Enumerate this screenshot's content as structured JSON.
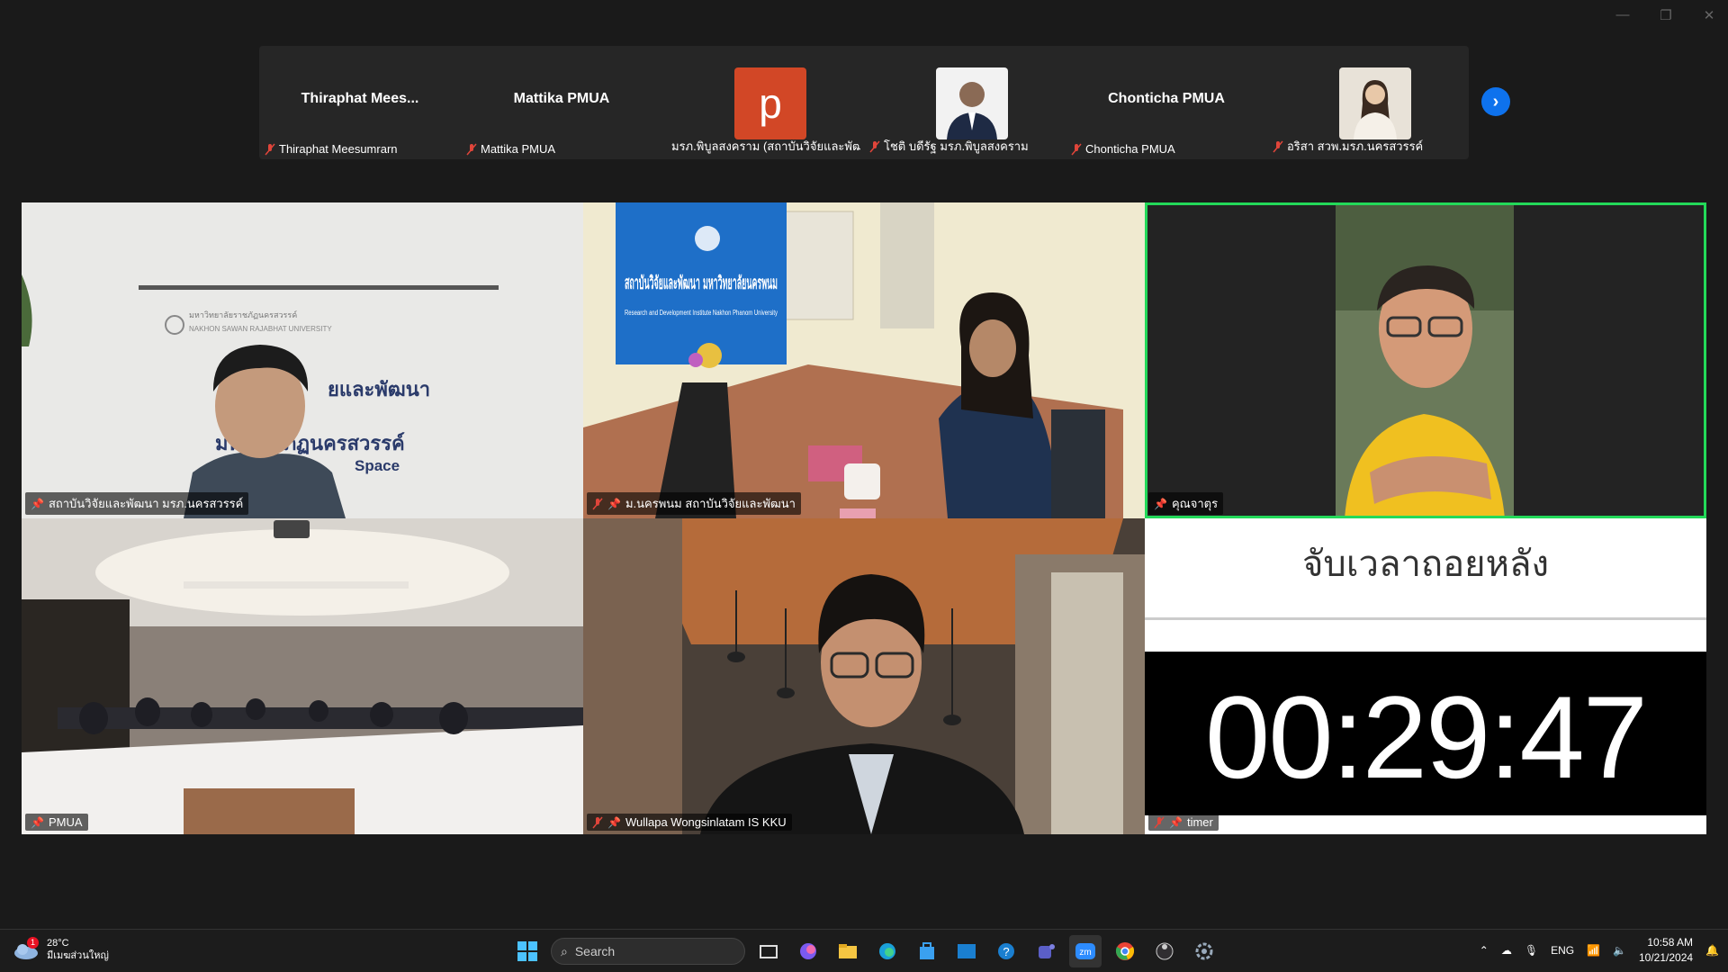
{
  "window": {
    "minimize": "—",
    "restore": "❐",
    "close": "✕"
  },
  "filmstrip": {
    "tiles": [
      {
        "display_name": "Thiraphat  Mees...",
        "label": "Thiraphat Meesumrarn"
      },
      {
        "display_name": "Mattika PMUA",
        "label": "Mattika PMUA"
      },
      {
        "avatar_letter": "p",
        "label": "มรภ.พิบูลสงคราม (สถาบันวิจัยและพัฒ..."
      },
      {
        "label": "โชติ บดีรัฐ มรภ.พิบูลสงคราม"
      },
      {
        "display_name": "Chonticha PMUA",
        "label": "Chonticha PMUA"
      },
      {
        "label": "อริสา สวพ.มรภ.นครสวรรค์"
      }
    ],
    "next_button": "›"
  },
  "grid": {
    "tiles": [
      {
        "label": "สถาบันวิจัยและพัฒนา มรภ.นครสวรรค์"
      },
      {
        "label": "ม.นครพนม สถาบันวิจัยและพัฒนา",
        "banner_th": "สถาบันวิจัยและพัฒนา มหาวิทยาลัยนครพนม",
        "banner_en": "Research and Development Institute Nakhon Phanom University"
      },
      {
        "label": "คุณจาตุร"
      },
      {
        "label": "PMUA"
      },
      {
        "label": "Wullapa Wongsinlatam IS KKU"
      },
      {
        "label": "timer",
        "title": "จับเวลาถอยหลัง",
        "countdown": "00:29:47"
      }
    ],
    "tile1_wall": {
      "line1": "ยและพัฒนา",
      "line2": "มห      ราชภัฏนครสวรรค์",
      "line3": "Space",
      "uni": "NAKHON SAWAN RAJABHAT UNIVERSITY"
    }
  },
  "taskbar": {
    "weather_temp": "28°C",
    "weather_desc": "มีเมฆส่วนใหญ่",
    "weather_badge": "1",
    "search_placeholder": "Search",
    "lang": "ENG",
    "time": "10:58 AM",
    "date": "10/21/2024"
  },
  "colors": {
    "active_speaker": "#23d959",
    "accent": "#0e72ed",
    "muted": "#e0453a"
  }
}
